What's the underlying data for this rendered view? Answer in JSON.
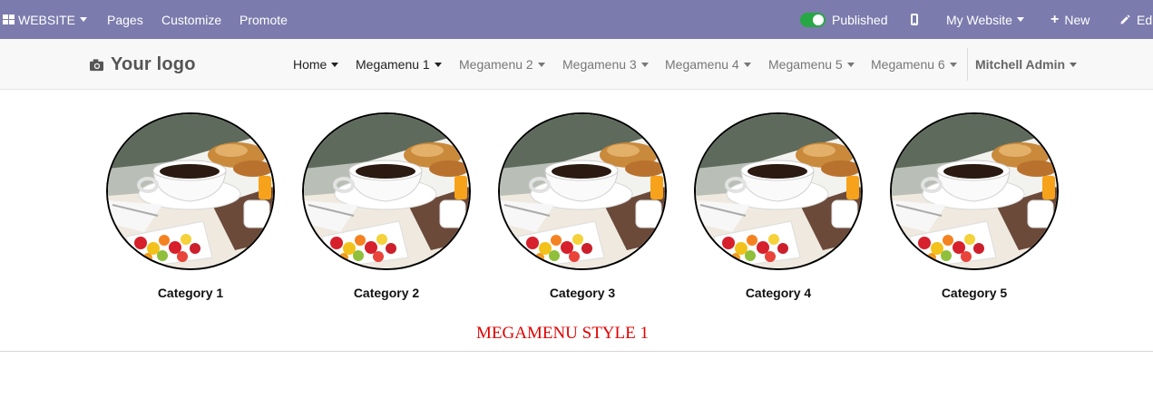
{
  "admin_bar": {
    "app_label": "WEBSITE",
    "menu_pages": "Pages",
    "menu_customize": "Customize",
    "menu_promote": "Promote",
    "published_label": "Published",
    "website_selector": "My Website",
    "new_label": "New",
    "edit_label": "Ed",
    "bar_color": "#7c7bad",
    "published_toggle_color": "#28a745"
  },
  "navbar": {
    "logo_text": "Your logo",
    "items": [
      {
        "label": "Home"
      },
      {
        "label": "Megamenu 1"
      },
      {
        "label": "Megamenu 2"
      },
      {
        "label": "Megamenu 3"
      },
      {
        "label": "Megamenu 4"
      },
      {
        "label": "Megamenu 5"
      },
      {
        "label": "Megamenu 6"
      }
    ],
    "user_name": "Mitchell Admin"
  },
  "megamenu": {
    "categories": [
      {
        "label": "Category 1"
      },
      {
        "label": "Category 2"
      },
      {
        "label": "Category 3"
      },
      {
        "label": "Category 4"
      },
      {
        "label": "Category 5"
      }
    ],
    "style_title": "MEGAMENU STYLE 1",
    "style_title_color": "#e00000"
  }
}
